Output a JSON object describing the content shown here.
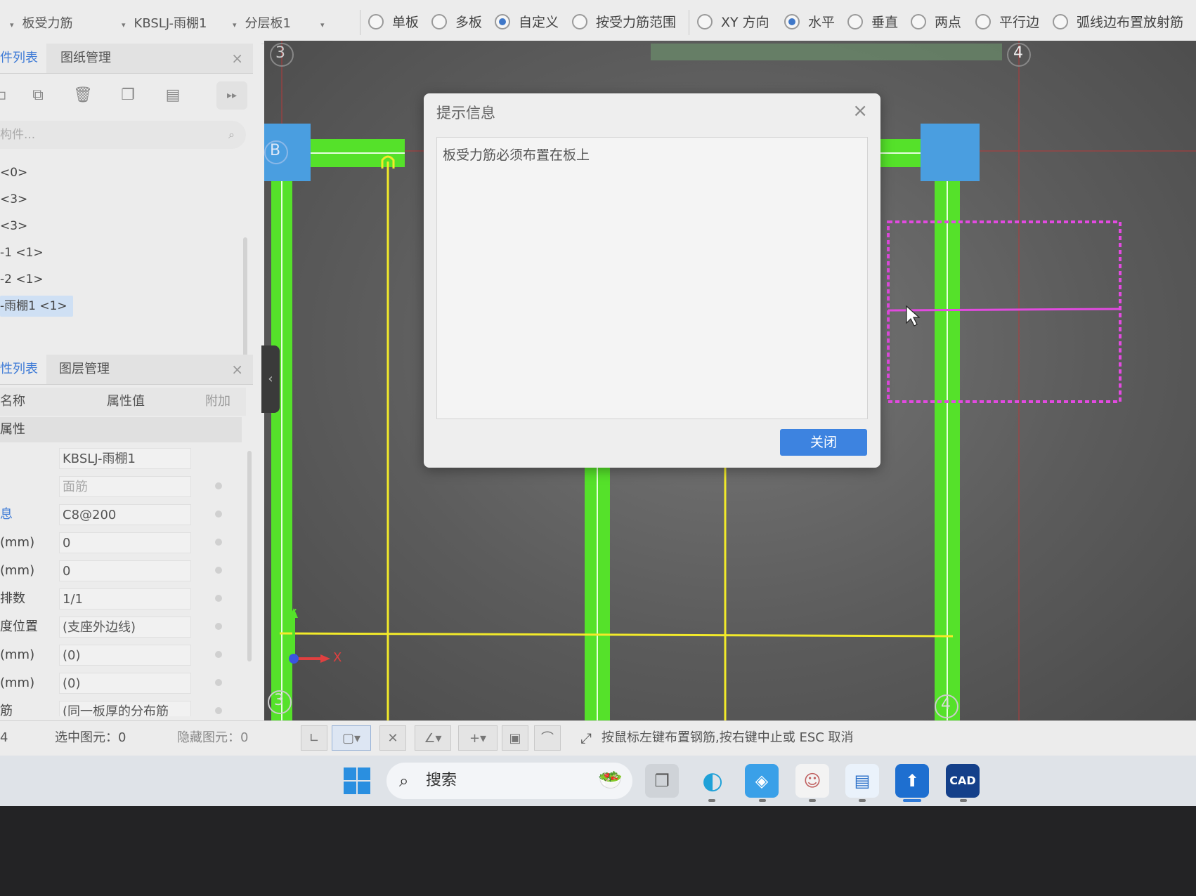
{
  "toolbar": {
    "dropdowns": [
      {
        "label": "板受力筋"
      },
      {
        "label": "KBSLJ-雨棚1"
      },
      {
        "label": "分层板1"
      }
    ],
    "radios": [
      {
        "label": "单板",
        "selected": false
      },
      {
        "label": "多板",
        "selected": false
      },
      {
        "label": "自定义",
        "selected": true
      },
      {
        "label": "按受力筋范围",
        "selected": false
      },
      {
        "label": "XY 方向",
        "selected": false
      },
      {
        "label": "水平",
        "selected": true
      },
      {
        "label": "垂直",
        "selected": false
      },
      {
        "label": "两点",
        "selected": false
      },
      {
        "label": "平行边",
        "selected": false
      },
      {
        "label": "弧线边布置放射筋",
        "selected": false
      }
    ]
  },
  "component_panel": {
    "tabs": [
      "件列表",
      "图纸管理"
    ],
    "close_icon": "×",
    "search_placeholder": "构件...",
    "items": [
      {
        "label": "<0>",
        "selected": false
      },
      {
        "label": "<3>",
        "selected": false
      },
      {
        "label": "<3>",
        "selected": false
      },
      {
        "label": "-1 <1>",
        "selected": false
      },
      {
        "label": "-2 <1>",
        "selected": false
      },
      {
        "label": "-雨棚1 <1>",
        "selected": true
      }
    ]
  },
  "property_panel": {
    "tabs": [
      "性列表",
      "图层管理"
    ],
    "close_icon": "×",
    "headers": {
      "name": "名称",
      "value": "属性值",
      "extra": "附加"
    },
    "group": "属性",
    "rows": [
      {
        "name": "",
        "value": "KBSLJ-雨棚1",
        "blue": false,
        "gray": false
      },
      {
        "name": "",
        "value": "面筋",
        "blue": false,
        "gray": true
      },
      {
        "name": "息",
        "value": "C8@200",
        "blue": true,
        "gray": false
      },
      {
        "name": "(mm)",
        "value": "0",
        "blue": false,
        "gray": false
      },
      {
        "name": "(mm)",
        "value": "0",
        "blue": false,
        "gray": false
      },
      {
        "name": "排数",
        "value": "1/1",
        "blue": false,
        "gray": false
      },
      {
        "name": "度位置",
        "value": "(支座外边线)",
        "blue": false,
        "gray": false
      },
      {
        "name": "(mm)",
        "value": "(0)",
        "blue": false,
        "gray": false
      },
      {
        "name": "(mm)",
        "value": "(0)",
        "blue": false,
        "gray": false
      },
      {
        "name": "筋",
        "value": "(同一板厚的分布筋",
        "blue": false,
        "gray": false
      }
    ]
  },
  "canvas": {
    "axis_labels": {
      "top_left": "3",
      "top_right": "4",
      "left_row": "B",
      "bottom_left": "3",
      "bottom_right": "4"
    },
    "ucs": {
      "x": "X",
      "y": "Y"
    },
    "colors": {
      "beam": "#55e12a",
      "column": "#4a9ee0",
      "rebar": "#f2ea2a",
      "selection": "#e24ae0"
    }
  },
  "dialog": {
    "title": "提示信息",
    "message": "板受力筋必须布置在板上",
    "button": "关闭",
    "close_icon": "×"
  },
  "statusbar": {
    "left_count": "4",
    "selected": "选中图元：0",
    "hidden": "隐藏图元：0",
    "hint": "按鼠标左键布置钢筋,按右键中止或 ESC 取消"
  },
  "taskbar": {
    "search_text": "搜索"
  }
}
